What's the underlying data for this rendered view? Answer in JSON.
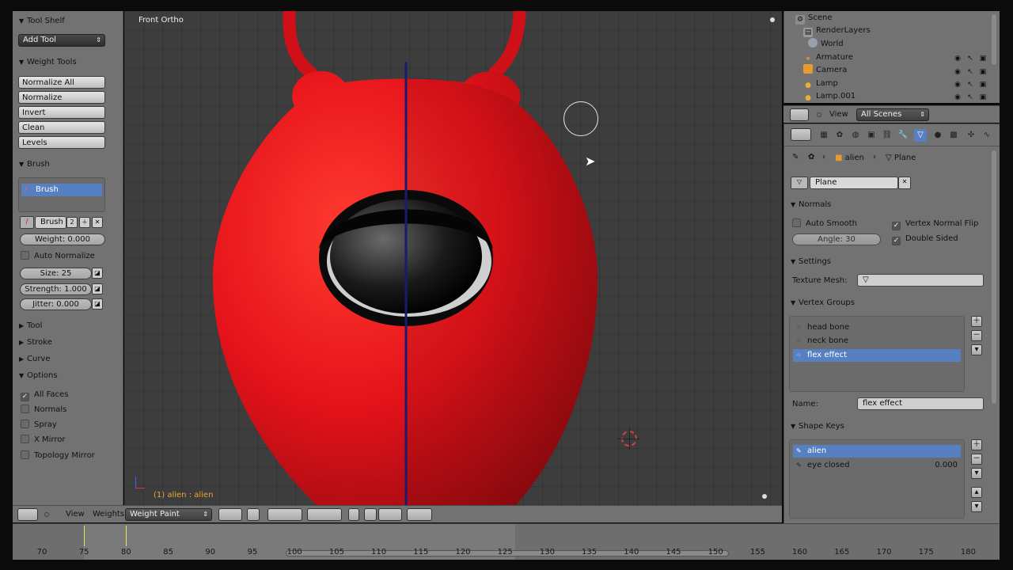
{
  "tool_shelf": {
    "title": "Tool Shelf",
    "add_tool": "Add Tool",
    "weight_tools": {
      "title": "Weight Tools",
      "buttons": [
        "Normalize All",
        "Normalize",
        "Invert",
        "Clean",
        "Levels"
      ]
    },
    "brush": {
      "title": "Brush",
      "selected_brush": "Brush",
      "brush_name": "Brush",
      "users": "2",
      "weight": "Weight: 0.000",
      "auto_normalize": "Auto Normalize",
      "size": "Size: 25",
      "strength": "Strength: 1.000",
      "jitter": "Jitter: 0.000"
    },
    "collapsed_panels": [
      "Tool",
      "Stroke",
      "Curve"
    ],
    "options": {
      "title": "Options",
      "items": [
        {
          "label": "All Faces",
          "checked": true
        },
        {
          "label": "Normals",
          "checked": false
        },
        {
          "label": "Spray",
          "checked": false
        },
        {
          "label": "X Mirror",
          "checked": false
        },
        {
          "label": "Topology Mirror",
          "checked": false
        }
      ]
    }
  },
  "viewport": {
    "label": "Front Ortho",
    "status": "(1) alien : alien",
    "model_color": "#e31018"
  },
  "view_header": {
    "menus": [
      "View",
      "Weights"
    ],
    "mode": "Weight Paint"
  },
  "timeline": {
    "frames": [
      "70",
      "75",
      "80",
      "85",
      "90",
      "95",
      "100",
      "105",
      "110",
      "115",
      "120",
      "125",
      "130",
      "135",
      "140",
      "145",
      "150",
      "155",
      "160",
      "165",
      "170",
      "175",
      "180"
    ],
    "keyframes": [
      "75",
      "80"
    ]
  },
  "outliner": {
    "items": [
      "Scene",
      "RenderLayers",
      "World",
      "Armature",
      "Camera",
      "Lamp",
      "Lamp.001"
    ],
    "view_menu": "View",
    "scenes": "All Scenes"
  },
  "properties": {
    "breadcrumb": {
      "object": "alien",
      "data": "Plane"
    },
    "mesh_name": "Plane",
    "normals": {
      "title": "Normals",
      "auto_smooth": "Auto Smooth",
      "angle": "Angle: 30",
      "vertex_normal_flip": "Vertex Normal Flip",
      "double_sided": "Double Sided"
    },
    "settings": {
      "title": "Settings",
      "texture_mesh": "Texture Mesh:"
    },
    "vertex_groups": {
      "title": "Vertex Groups",
      "items": [
        "head bone",
        "neck bone",
        "flex effect"
      ],
      "selected": "flex effect",
      "name_label": "Name:",
      "name_value": "flex effect"
    },
    "shape_keys": {
      "title": "Shape Keys",
      "items": [
        {
          "name": "alien",
          "value": ""
        },
        {
          "name": "eye closed",
          "value": "0.000"
        }
      ]
    }
  }
}
